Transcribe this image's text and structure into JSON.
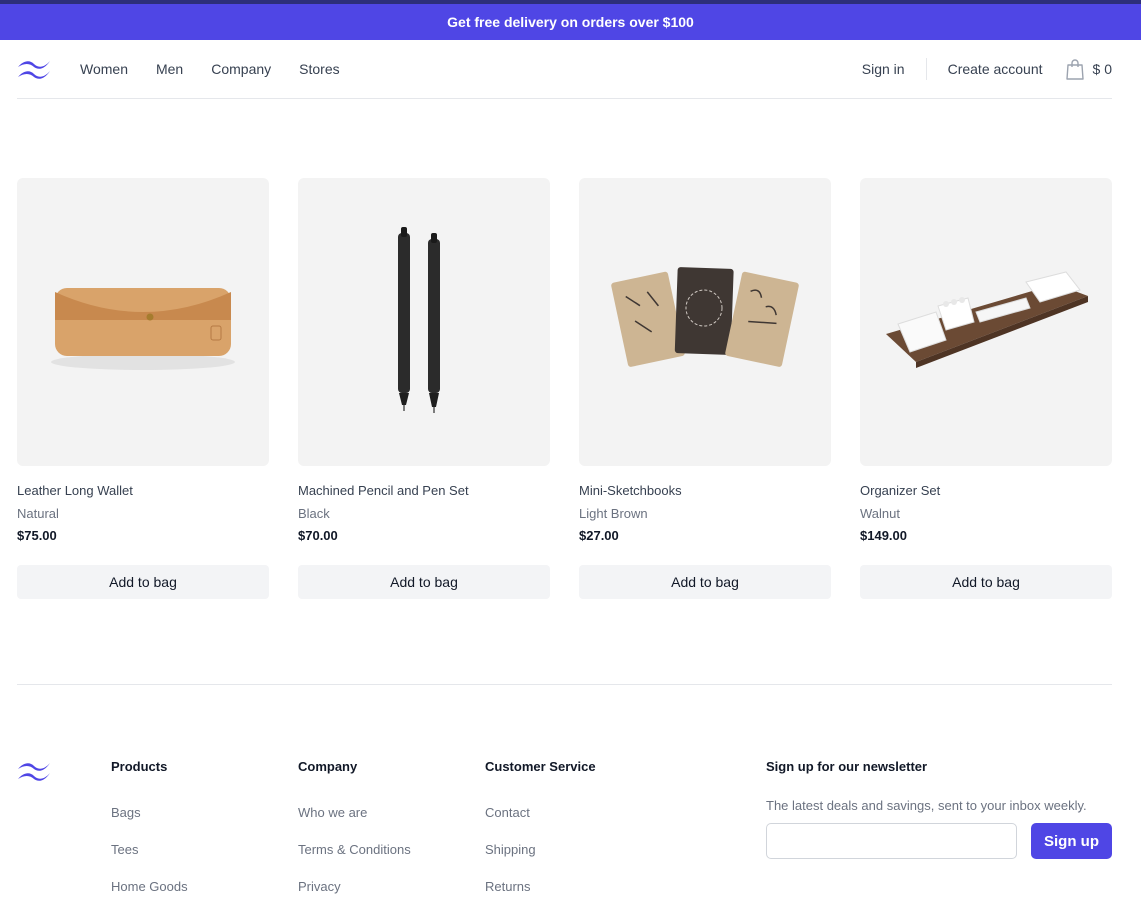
{
  "colors": {
    "brand": "#4f46e5",
    "muted_bg": "#f3f4f6"
  },
  "promo": {
    "text": "Get free delivery on orders over $100"
  },
  "nav": {
    "items": [
      {
        "label": "Women"
      },
      {
        "label": "Men"
      },
      {
        "label": "Company"
      },
      {
        "label": "Stores"
      }
    ]
  },
  "account": {
    "sign_in": "Sign in",
    "create_account": "Create account",
    "cart_total": "$ 0"
  },
  "products": [
    {
      "name": "Leather Long Wallet",
      "color": "Natural",
      "price": "$75.00",
      "button": "Add to bag",
      "image_icon": "wallet"
    },
    {
      "name": "Machined Pencil and Pen Set",
      "color": "Black",
      "price": "$70.00",
      "button": "Add to bag",
      "image_icon": "pens"
    },
    {
      "name": "Mini-Sketchbooks",
      "color": "Light Brown",
      "price": "$27.00",
      "button": "Add to bag",
      "image_icon": "sketchbooks"
    },
    {
      "name": "Organizer Set",
      "color": "Walnut",
      "price": "$149.00",
      "button": "Add to bag",
      "image_icon": "organizer"
    }
  ],
  "footer": {
    "columns": [
      {
        "title": "Products",
        "links": [
          "Bags",
          "Tees",
          "Home Goods"
        ]
      },
      {
        "title": "Company",
        "links": [
          "Who we are",
          "Terms & Conditions",
          "Privacy"
        ]
      },
      {
        "title": "Customer Service",
        "links": [
          "Contact",
          "Shipping",
          "Returns"
        ]
      }
    ],
    "newsletter": {
      "title": "Sign up for our newsletter",
      "description": "The latest deals and savings, sent to your inbox weekly.",
      "email_value": "",
      "button": "Sign up"
    }
  }
}
